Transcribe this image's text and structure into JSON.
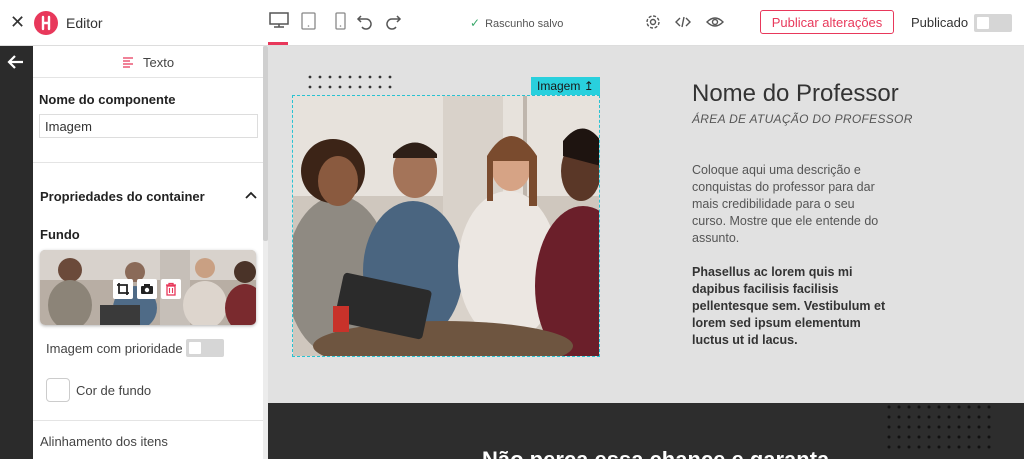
{
  "topbar": {
    "editor_title": "Editor",
    "draft_status": "Rascunho salvo",
    "publish_label": "Publicar alterações",
    "published_label": "Publicado"
  },
  "panel": {
    "header_title": "Texto",
    "component_name_label": "Nome do componente",
    "component_name_value": "Imagem",
    "container_props_label": "Propriedades do container",
    "background_label": "Fundo",
    "priority_label": "Imagem com prioridade",
    "bg_color_label": "Cor de fundo",
    "alignment_label": "Alinhamento dos itens"
  },
  "canvas": {
    "image_tag": "Imagem",
    "prof_name": "Nome do Professor",
    "prof_area": "ÁREA DE ATUAÇÃO DO PROFESSOR",
    "prof_description": "Coloque aqui uma descrição e conquistas do professor para dar mais credibilidade para o seu curso. Mostre que ele entende do assunto.",
    "prof_bold": "Phasellus ac lorem quis mi dapibus facilisis facilisis pellentesque sem. Vestibulum et lorem sed ipsum elementum luctus ut id lacus.",
    "dark_heading": "Não perca essa chance e garanta"
  },
  "colors": {
    "accent": "#e8385b",
    "selection": "#29d0dd",
    "dark_strip": "#2b2b2b",
    "canvas_bg": "#e1e1e1"
  },
  "icons": {
    "close": "close-icon",
    "desktop": "desktop-icon",
    "tablet": "tablet-icon",
    "mobile": "mobile-icon",
    "undo": "undo-icon",
    "redo": "redo-icon",
    "gear": "gear-icon",
    "code": "code-icon",
    "eye": "eye-icon",
    "back": "arrow-left-icon",
    "crop": "crop-icon",
    "camera": "camera-icon",
    "trash": "trash-icon"
  }
}
